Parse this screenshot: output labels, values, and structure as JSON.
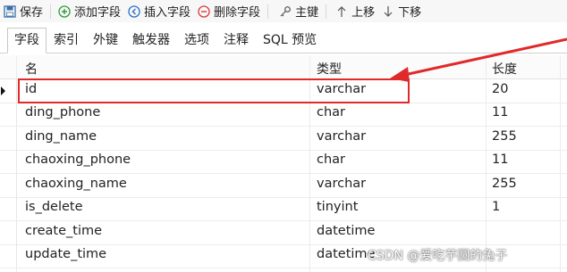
{
  "toolbar": {
    "save": "保存",
    "add_field": "添加字段",
    "insert_field": "插入字段",
    "delete_field": "删除字段",
    "primary_key": "主键",
    "move_up": "上移",
    "move_down": "下移"
  },
  "tabs": [
    "字段",
    "索引",
    "外键",
    "触发器",
    "选项",
    "注释",
    "SQL 预览"
  ],
  "grid": {
    "headers": {
      "name": "名",
      "type": "类型",
      "length": "长度"
    },
    "rows": [
      {
        "name": "id",
        "type": "varchar",
        "length": "20"
      },
      {
        "name": "ding_phone",
        "type": "char",
        "length": "11"
      },
      {
        "name": "ding_name",
        "type": "varchar",
        "length": "255"
      },
      {
        "name": "chaoxing_phone",
        "type": "char",
        "length": "11"
      },
      {
        "name": "chaoxing_name",
        "type": "varchar",
        "length": "255"
      },
      {
        "name": "is_delete",
        "type": "tinyint",
        "length": "1"
      },
      {
        "name": "create_time",
        "type": "datetime",
        "length": ""
      },
      {
        "name": "update_time",
        "type": "datetime",
        "length": ""
      }
    ]
  },
  "watermark": "CSDN @爱吃芋圆的兔子",
  "colors": {
    "highlight": "#e0292a",
    "add": "#2e9a3e",
    "insert": "#2a6fc9",
    "delete": "#d9383a"
  }
}
